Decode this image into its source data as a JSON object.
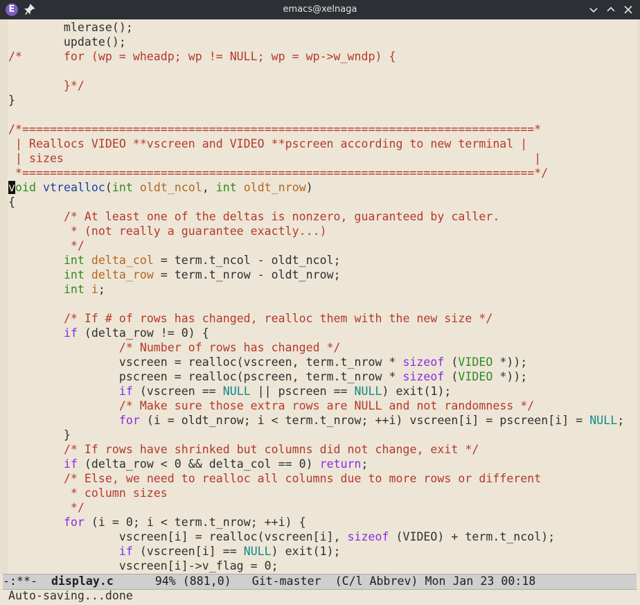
{
  "window": {
    "title": "emacs@xelnaga",
    "app_logo": "E",
    "icons": {
      "app": "emacs-logo",
      "pin": "pin-icon",
      "minimize": "chevron-down-icon",
      "maximize": "chevron-up-icon",
      "close": "close-icon"
    }
  },
  "colors": {
    "background": "#ede6d6",
    "comment": "#b5382b",
    "keyword": "#8a2be2",
    "type": "#2e8b22",
    "variable": "#b5651d",
    "function": "#1a3fa8",
    "constant": "#0e8a8a",
    "modeline_bg": "#cfcfcf"
  },
  "code_lines": [
    [
      [
        "",
        "        mlerase();"
      ]
    ],
    [
      [
        "",
        "        update();"
      ]
    ],
    [
      [
        "cm",
        "/*      for (wp = wheadp; wp != NULL; wp = wp->w_wndp) {"
      ]
    ],
    [
      [
        "",
        ""
      ]
    ],
    [
      [
        "cm",
        "        }*/"
      ]
    ],
    [
      [
        "",
        "}"
      ]
    ],
    [
      [
        "",
        ""
      ]
    ],
    [
      [
        "cm",
        "/*==========================================================================*"
      ]
    ],
    [
      [
        "cm",
        " | Reallocs VIDEO **vscreen and VIDEO **pscreen according to new terminal |"
      ]
    ],
    [
      [
        "cm",
        " | sizes                                                                    |"
      ]
    ],
    [
      [
        "cm",
        " *==========================================================================*/"
      ]
    ],
    [
      [
        "cursor",
        "v"
      ],
      [
        "ty",
        "oid"
      ],
      [
        "",
        " "
      ],
      [
        "fn",
        "vtrealloc"
      ],
      [
        "",
        "("
      ],
      [
        "ty",
        "int"
      ],
      [
        "",
        " "
      ],
      [
        "vr",
        "oldt_ncol"
      ],
      [
        "",
        ", "
      ],
      [
        "ty",
        "int"
      ],
      [
        "",
        " "
      ],
      [
        "vr",
        "oldt_nrow"
      ],
      [
        "",
        ")"
      ]
    ],
    [
      [
        "",
        "{"
      ]
    ],
    [
      [
        "",
        "        "
      ],
      [
        "cm",
        "/* At least one of the deltas is nonzero, guaranteed by caller."
      ]
    ],
    [
      [
        "cm",
        "         * (not really a guarantee exactly...)"
      ]
    ],
    [
      [
        "cm",
        "         */"
      ]
    ],
    [
      [
        "",
        "        "
      ],
      [
        "ty",
        "int"
      ],
      [
        "",
        " "
      ],
      [
        "vr",
        "delta_col"
      ],
      [
        "",
        " = term.t_ncol - oldt_ncol;"
      ]
    ],
    [
      [
        "",
        "        "
      ],
      [
        "ty",
        "int"
      ],
      [
        "",
        " "
      ],
      [
        "vr",
        "delta_row"
      ],
      [
        "",
        " = term.t_nrow - oldt_nrow;"
      ]
    ],
    [
      [
        "",
        "        "
      ],
      [
        "ty",
        "int"
      ],
      [
        "",
        " "
      ],
      [
        "vr",
        "i"
      ],
      [
        "",
        ";"
      ]
    ],
    [
      [
        "",
        ""
      ]
    ],
    [
      [
        "",
        "        "
      ],
      [
        "cm",
        "/* If # of rows has changed, realloc them with the new size */"
      ]
    ],
    [
      [
        "",
        "        "
      ],
      [
        "kw",
        "if"
      ],
      [
        "",
        " (delta_row != 0) {"
      ]
    ],
    [
      [
        "",
        "                "
      ],
      [
        "cm",
        "/* Number of rows has changed */"
      ]
    ],
    [
      [
        "",
        "                vscreen = realloc(vscreen, term.t_nrow * "
      ],
      [
        "kw",
        "sizeof"
      ],
      [
        "",
        " ("
      ],
      [
        "ty",
        "VIDEO"
      ],
      [
        "",
        " *));"
      ]
    ],
    [
      [
        "",
        "                pscreen = realloc(pscreen, term.t_nrow * "
      ],
      [
        "kw",
        "sizeof"
      ],
      [
        "",
        " ("
      ],
      [
        "ty",
        "VIDEO"
      ],
      [
        "",
        " *));"
      ]
    ],
    [
      [
        "",
        "                "
      ],
      [
        "kw",
        "if"
      ],
      [
        "",
        " (vscreen == "
      ],
      [
        "cn",
        "NULL"
      ],
      [
        "",
        " || pscreen == "
      ],
      [
        "cn",
        "NULL"
      ],
      [
        "",
        ") exit(1);"
      ]
    ],
    [
      [
        "",
        "                "
      ],
      [
        "cm",
        "/* Make sure those extra rows are NULL and not randomness */"
      ]
    ],
    [
      [
        "",
        "                "
      ],
      [
        "kw",
        "for"
      ],
      [
        "",
        " (i = oldt_nrow; i < term.t_nrow; ++i) vscreen[i] = pscreen[i] = "
      ],
      [
        "cn",
        "NULL"
      ],
      [
        "",
        ";"
      ]
    ],
    [
      [
        "",
        "        }"
      ]
    ],
    [
      [
        "",
        "        "
      ],
      [
        "cm",
        "/* If rows have shrinked but columns did not change, exit */"
      ]
    ],
    [
      [
        "",
        "        "
      ],
      [
        "kw",
        "if"
      ],
      [
        "",
        " (delta_row < 0 && delta_col == 0) "
      ],
      [
        "kw",
        "return"
      ],
      [
        "",
        ";"
      ]
    ],
    [
      [
        "",
        "        "
      ],
      [
        "cm",
        "/* Else, we need to realloc all columns due to more rows or different"
      ]
    ],
    [
      [
        "cm",
        "         * column sizes"
      ]
    ],
    [
      [
        "cm",
        "         */"
      ]
    ],
    [
      [
        "",
        "        "
      ],
      [
        "kw",
        "for"
      ],
      [
        "",
        " (i = 0; i < term.t_nrow; ++i) {"
      ]
    ],
    [
      [
        "",
        "                vscreen[i] = realloc(vscreen[i], "
      ],
      [
        "kw",
        "sizeof"
      ],
      [
        "",
        " (VIDEO) + term.t_ncol);"
      ]
    ],
    [
      [
        "",
        "                "
      ],
      [
        "kw",
        "if"
      ],
      [
        "",
        " (vscreen[i] == "
      ],
      [
        "cn",
        "NULL"
      ],
      [
        "",
        ") exit(1);"
      ]
    ],
    [
      [
        "",
        "                vscreen[i]->v_flag = 0;"
      ]
    ]
  ],
  "modeline": {
    "status": "-:**-",
    "buffer": "display.c",
    "position": "94% (881,0)",
    "vc": "Git-master",
    "modes": "(C/l Abbrev)",
    "datetime": "Mon Jan 23 00:18"
  },
  "echo_area": "Auto-saving...done"
}
